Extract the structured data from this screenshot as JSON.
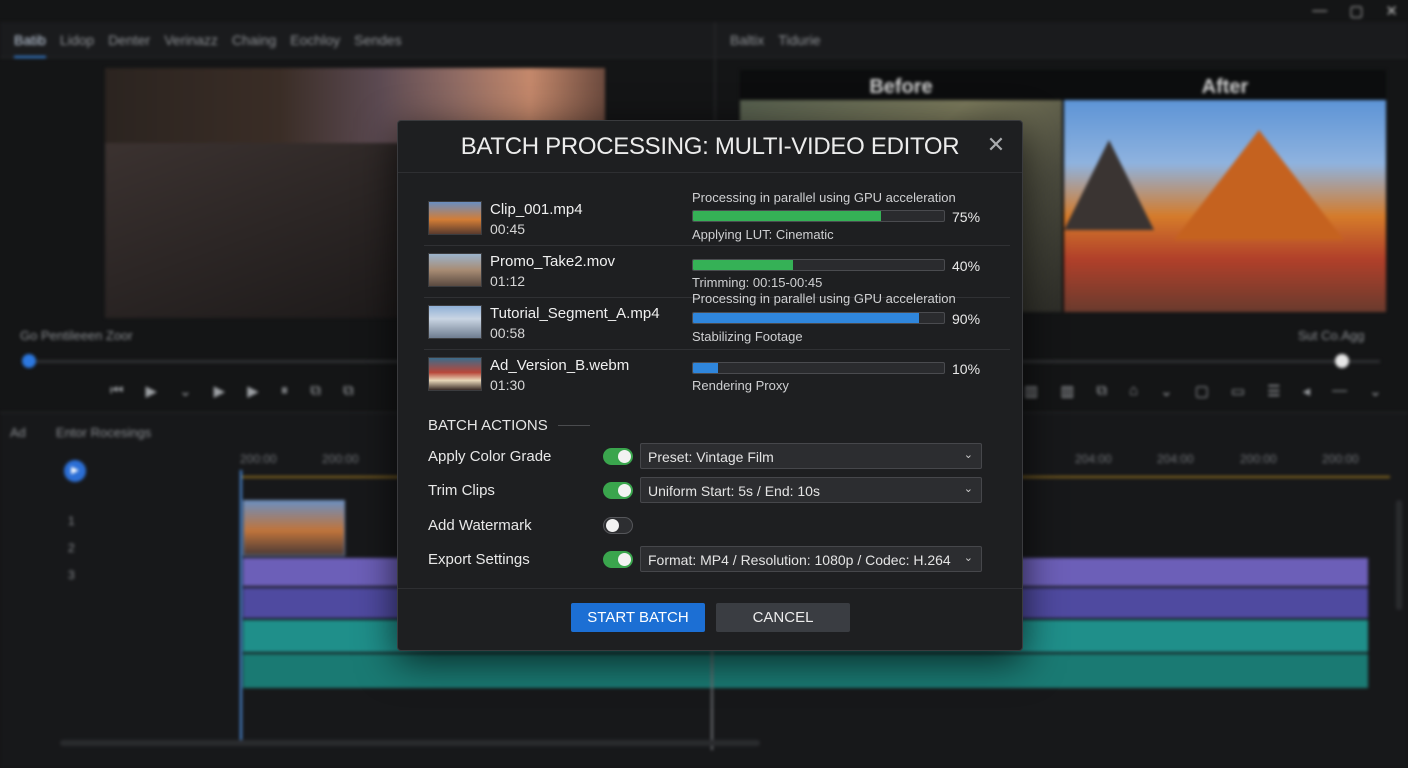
{
  "window_controls": {
    "minimize": "—",
    "maximize": "▢",
    "close": "✕"
  },
  "background": {
    "tabs": [
      "Batib",
      "Lidop",
      "Denter",
      "Verinazz",
      "Chaing",
      "Eochloy",
      "Sendes"
    ],
    "right_tabs": [
      "Baltix",
      "Tidurie"
    ],
    "before_label": "Before",
    "after_label": "After",
    "left_caption": "Go Pentileeen Zoor",
    "right_caption": "Sut Co.Agg",
    "timeline_title": [
      "Ad",
      "Entor Rocesings"
    ],
    "ruler_labels": [
      "200:00",
      "200:00",
      "204:00",
      "204:00",
      "200:00",
      "200:00"
    ],
    "track_numbers": [
      "1",
      "2",
      "3"
    ]
  },
  "dialog": {
    "title": "BATCH PROCESSING: MULTI-VIDEO EDITOR",
    "clips": [
      {
        "name": "Clip_001.mp4",
        "duration": "00:45",
        "status_top": "Processing in parallel using GPU acceleration",
        "status_bottom": "Applying LUT: Cinematic",
        "progress": 0.75,
        "percent": "75%",
        "bar_color": "#35b156"
      },
      {
        "name": "Promo_Take2.mov",
        "duration": "01:12",
        "status_top": "",
        "status_bottom": "Trimming: 00:15-00:45",
        "progress": 0.4,
        "percent": "40%",
        "bar_color": "#35b156"
      },
      {
        "name": "Tutorial_Segment_A.mp4",
        "duration": "00:58",
        "status_top": "Processing in parallel using GPU acceleration",
        "status_bottom": "Stabilizing Footage",
        "progress": 0.9,
        "percent": "90%",
        "bar_color": "#2f86dc"
      },
      {
        "name": "Ad_Version_B.webm",
        "duration": "01:30",
        "status_top": "",
        "status_bottom": "Rendering Proxy",
        "progress": 0.1,
        "percent": "10%",
        "bar_color": "#2f86dc"
      }
    ],
    "batch_actions_label": "BATCH ACTIONS",
    "actions": [
      {
        "label": "Apply Color Grade",
        "enabled": true,
        "select_value": "Preset: Vintage Film"
      },
      {
        "label": "Trim Clips",
        "enabled": true,
        "select_value": "Uniform Start: 5s / End: 10s"
      },
      {
        "label": "Add Watermark",
        "enabled": false,
        "select_value": ""
      },
      {
        "label": "Export Settings",
        "enabled": true,
        "select_value": "Format: MP4 / Resolution: 1080p / Codec: H.264"
      }
    ],
    "start_label": "START BATCH",
    "cancel_label": "CANCEL",
    "close_icon": "close-icon"
  },
  "colors": {
    "accent": "#1c6fd4",
    "toggle_on": "#3aa54d"
  }
}
